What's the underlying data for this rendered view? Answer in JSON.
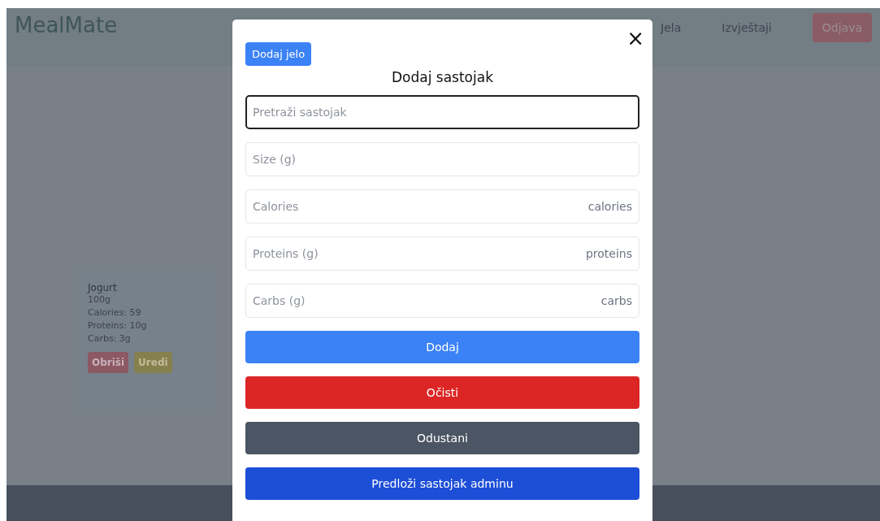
{
  "header": {
    "logo": "MealMate",
    "nav": [
      "Jela",
      "Izvještaji"
    ],
    "logout": "Odjava"
  },
  "card": {
    "name": "Jogurt",
    "lines": [
      "100g",
      "Calories: 59",
      "Proteins: 10g",
      "Carbs: 3g"
    ],
    "buttons": [
      {
        "label": "Obriši",
        "kind": "danger"
      },
      {
        "label": "Uredi",
        "kind": "warning"
      }
    ]
  },
  "modal": {
    "top_button": "Dodaj jelo",
    "title": "Dodaj sastojak",
    "close": "×",
    "fields": [
      {
        "placeholder": "Pretraži sastojak",
        "focused": true
      },
      {
        "placeholder": "Size (g)",
        "focused": false
      },
      {
        "placeholder": "Calories",
        "unit": "calories",
        "focused": false
      },
      {
        "placeholder": "Proteins (g)",
        "unit": "proteins",
        "focused": false
      },
      {
        "placeholder": "Carbs (g)",
        "unit": "carbs",
        "focused": false
      }
    ],
    "buttons": [
      {
        "label": "Dodaj",
        "kind": "primary"
      },
      {
        "label": "Očisti",
        "kind": "danger"
      },
      {
        "label": "Odustani",
        "kind": "secondary"
      },
      {
        "label": "Predloži sastojak adminu",
        "kind": "submit"
      }
    ]
  }
}
